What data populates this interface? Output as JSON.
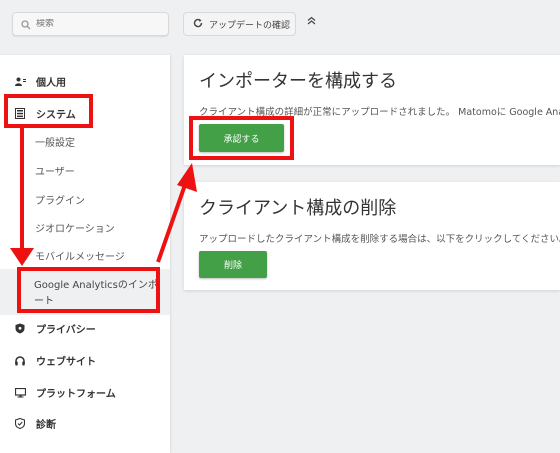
{
  "header": {
    "search_placeholder": "検索",
    "update_label": "アップデートの確認",
    "collapse_symbol": "⌃⌃"
  },
  "sidebar": {
    "personal": "個人用",
    "system": "システム",
    "system_items": [
      "一般設定",
      "ユーザー",
      "プラグイン",
      "ジオロケーション",
      "モバイルメッセージ"
    ],
    "active_item": "Google Analyticsのインポート",
    "privacy": "プライバシー",
    "websites": "ウェブサイト",
    "platform": "プラットフォーム",
    "diagnostics": "診断"
  },
  "importer_card": {
    "title": "インポーターを構成する",
    "message": "クライアント構成の詳細が正常にアップロードされました。 Matomoに Google Analytics",
    "authorize_button": "承認する"
  },
  "delete_card": {
    "title": "クライアント構成の削除",
    "message": "アップロードしたクライアント構成を削除する場合は、以下をクリックしてください。",
    "delete_button": "削除"
  },
  "colors": {
    "accent_green": "#43a047",
    "annotation_red": "#ee1111",
    "background": "#eef0f2"
  }
}
